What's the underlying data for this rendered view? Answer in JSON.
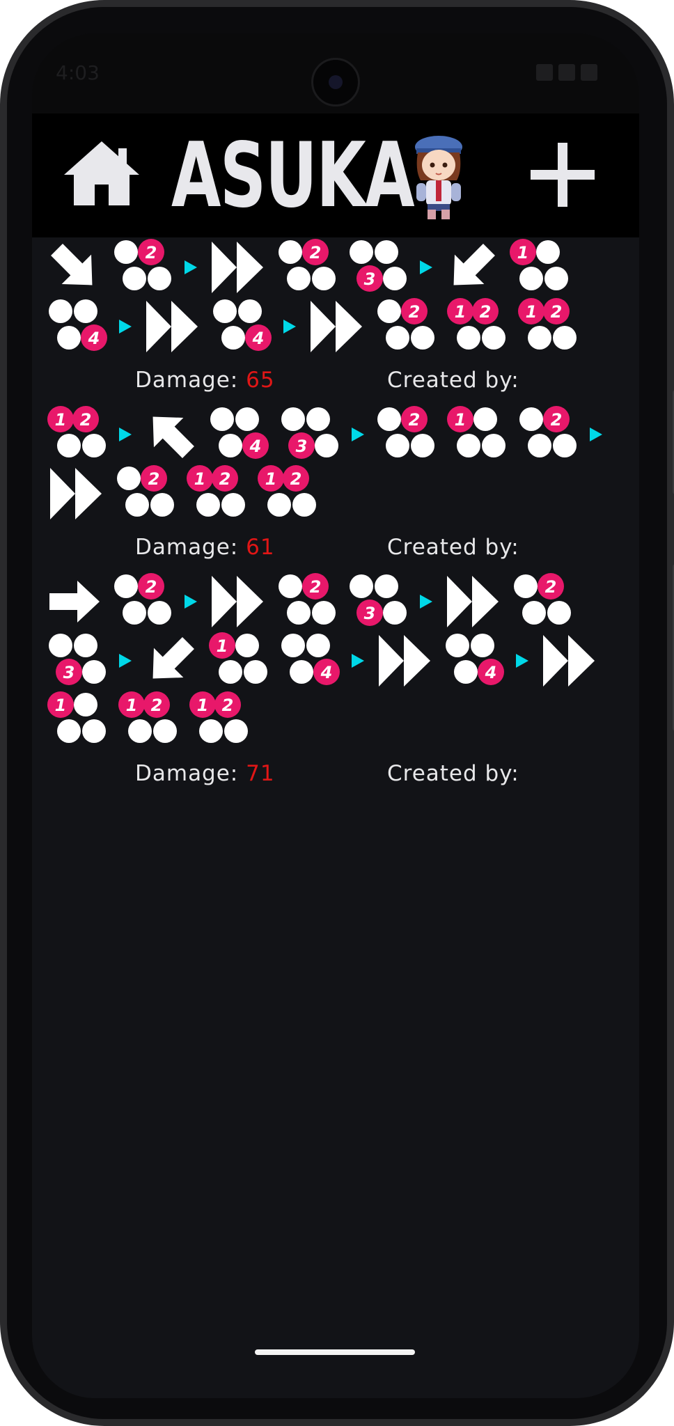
{
  "status": {
    "time": "4:03"
  },
  "header": {
    "title": "ASUKA"
  },
  "labels": {
    "damage": "Damage:",
    "created_by": "Created by:"
  },
  "colors": {
    "accent_pink": "#e8186a",
    "sequence_cyan": "#00d8e8",
    "damage_red": "#e01616",
    "header_bg": "#000000",
    "content_bg": "#121317"
  },
  "icons": {
    "home": "home-icon",
    "add": "plus-icon",
    "next": "sequence-arrow-icon",
    "dash": "forward-dash-icon"
  },
  "combos": [
    {
      "damage": "65",
      "creator": "",
      "moves": [
        {
          "t": "dir",
          "d": "down-forward"
        },
        {
          "t": "btn",
          "b": [
            2
          ]
        },
        {
          "t": "seq"
        },
        {
          "t": "dash"
        },
        {
          "t": "btn",
          "b": [
            2
          ]
        },
        {
          "t": "btn",
          "b": [
            3
          ]
        },
        {
          "t": "seq"
        },
        {
          "t": "dir",
          "d": "down-back"
        },
        {
          "t": "btn",
          "b": [
            1
          ]
        },
        {
          "t": "btn",
          "b": [
            4
          ]
        },
        {
          "t": "seq"
        },
        {
          "t": "dash"
        },
        {
          "t": "btn",
          "b": [
            4
          ]
        },
        {
          "t": "seq"
        },
        {
          "t": "dash"
        },
        {
          "t": "btn",
          "b": [
            2
          ]
        },
        {
          "t": "btn",
          "b": [
            1,
            2
          ]
        },
        {
          "t": "btn",
          "b": [
            1,
            2
          ]
        }
      ]
    },
    {
      "damage": "61",
      "creator": "",
      "moves": [
        {
          "t": "btn",
          "b": [
            1,
            2
          ]
        },
        {
          "t": "seq"
        },
        {
          "t": "dir",
          "d": "up-back"
        },
        {
          "t": "btn",
          "b": [
            4
          ]
        },
        {
          "t": "btn",
          "b": [
            3
          ]
        },
        {
          "t": "seq"
        },
        {
          "t": "btn",
          "b": [
            2
          ]
        },
        {
          "t": "btn",
          "b": [
            1
          ]
        },
        {
          "t": "btn",
          "b": [
            2
          ]
        },
        {
          "t": "seq"
        },
        {
          "t": "dash"
        },
        {
          "t": "btn",
          "b": [
            2
          ]
        },
        {
          "t": "btn",
          "b": [
            1,
            2
          ]
        },
        {
          "t": "btn",
          "b": [
            1,
            2
          ]
        }
      ]
    },
    {
      "damage": "71",
      "creator": "",
      "moves": [
        {
          "t": "dir",
          "d": "forward"
        },
        {
          "t": "btn",
          "b": [
            2
          ]
        },
        {
          "t": "seq"
        },
        {
          "t": "dash"
        },
        {
          "t": "btn",
          "b": [
            2
          ]
        },
        {
          "t": "btn",
          "b": [
            3
          ]
        },
        {
          "t": "seq"
        },
        {
          "t": "dash"
        },
        {
          "t": "btn",
          "b": [
            2
          ]
        },
        {
          "t": "btn",
          "b": [
            3
          ]
        },
        {
          "t": "seq"
        },
        {
          "t": "dir",
          "d": "down-back"
        },
        {
          "t": "btn",
          "b": [
            1
          ]
        },
        {
          "t": "btn",
          "b": [
            4
          ]
        },
        {
          "t": "seq"
        },
        {
          "t": "dash"
        },
        {
          "t": "btn",
          "b": [
            4
          ]
        },
        {
          "t": "seq"
        },
        {
          "t": "dash"
        },
        {
          "t": "btn",
          "b": [
            1
          ]
        },
        {
          "t": "btn",
          "b": [
            1,
            2
          ]
        },
        {
          "t": "btn",
          "b": [
            1,
            2
          ]
        }
      ]
    }
  ]
}
